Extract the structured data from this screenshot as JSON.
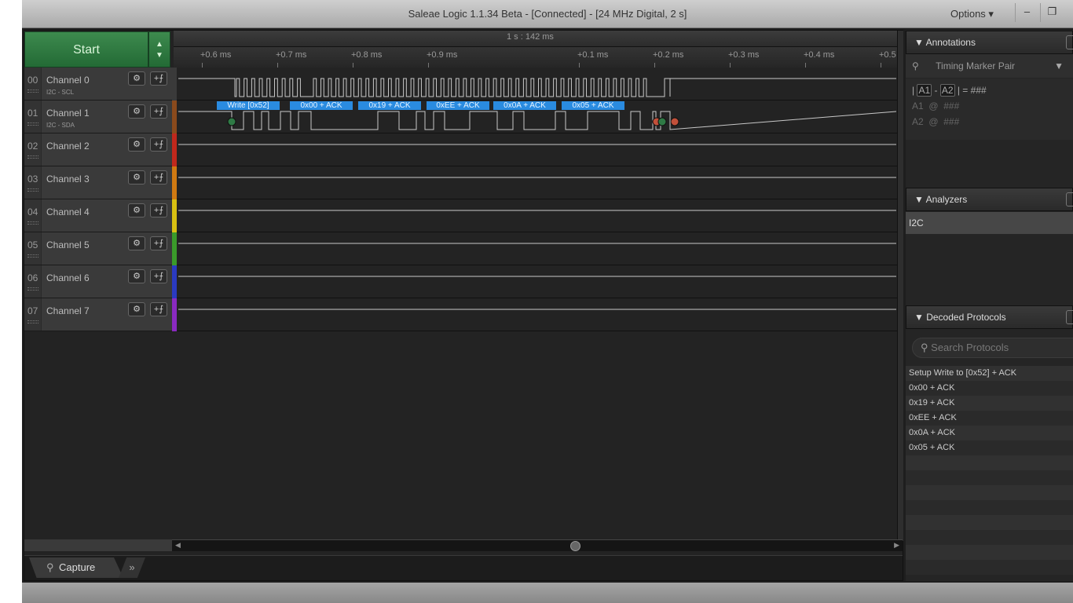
{
  "window": {
    "title": "Saleae Logic 1.1.34 Beta - [Connected] - [24 MHz Digital, 2 s]",
    "options_label": "Options ▾",
    "minimize": "–",
    "restore": "❐"
  },
  "start": {
    "label": "Start",
    "arrows": "▲▼"
  },
  "ruler": {
    "top_label": "1 s : 142 ms",
    "ticks": [
      "+0.6 ms",
      "+0.7 ms",
      "+0.8 ms",
      "+0.9 ms",
      "+0.1 ms",
      "+0.2 ms",
      "+0.3 ms",
      "+0.4 ms",
      "+0.5"
    ]
  },
  "channels": [
    {
      "num": "00",
      "name": "Channel 0",
      "sub": "I2C - SCL",
      "color": "#3a3a3a"
    },
    {
      "num": "01",
      "name": "Channel 1",
      "sub": "I2C - SDA",
      "color": "#8a4a1c"
    },
    {
      "num": "02",
      "name": "Channel 2",
      "sub": "",
      "color": "#c0281c"
    },
    {
      "num": "03",
      "name": "Channel 3",
      "sub": "",
      "color": "#d07a12"
    },
    {
      "num": "04",
      "name": "Channel 4",
      "sub": "",
      "color": "#d8c012"
    },
    {
      "num": "05",
      "name": "Channel 5",
      "sub": "",
      "color": "#3a9a2a"
    },
    {
      "num": "06",
      "name": "Channel 6",
      "sub": "",
      "color": "#2a3ac0"
    },
    {
      "num": "07",
      "name": "Channel 7",
      "sub": "",
      "color": "#8a2ac0"
    }
  ],
  "channel_button_icons": {
    "settings": "⚙",
    "trigger": "+⨍"
  },
  "decode_labels": [
    "Write [0x52]",
    "0x00 + ACK",
    "0x19 + ACK",
    "0xEE + ACK",
    "0x0A + ACK",
    "0x05 + ACK"
  ],
  "tabs": {
    "capture": "Capture",
    "more": "»"
  },
  "annotations": {
    "title": "Annotations",
    "marker": "Timing Marker Pair",
    "formula_a1": "A1",
    "formula_a2": "A2",
    "formula_value": "###",
    "a1": "A1",
    "a2": "A2",
    "at": "@",
    "a1_value": "###",
    "a2_value": "###"
  },
  "analyzers": {
    "title": "Analyzers",
    "items": [
      "I2C"
    ]
  },
  "decoded": {
    "title": "Decoded Protocols",
    "search_placeholder": "Search Protocols",
    "items": [
      "Setup Write to [0x52] + ACK",
      "0x00 + ACK",
      "0x19 + ACK",
      "0xEE + ACK",
      "0x0A + ACK",
      "0x05 + ACK"
    ]
  }
}
